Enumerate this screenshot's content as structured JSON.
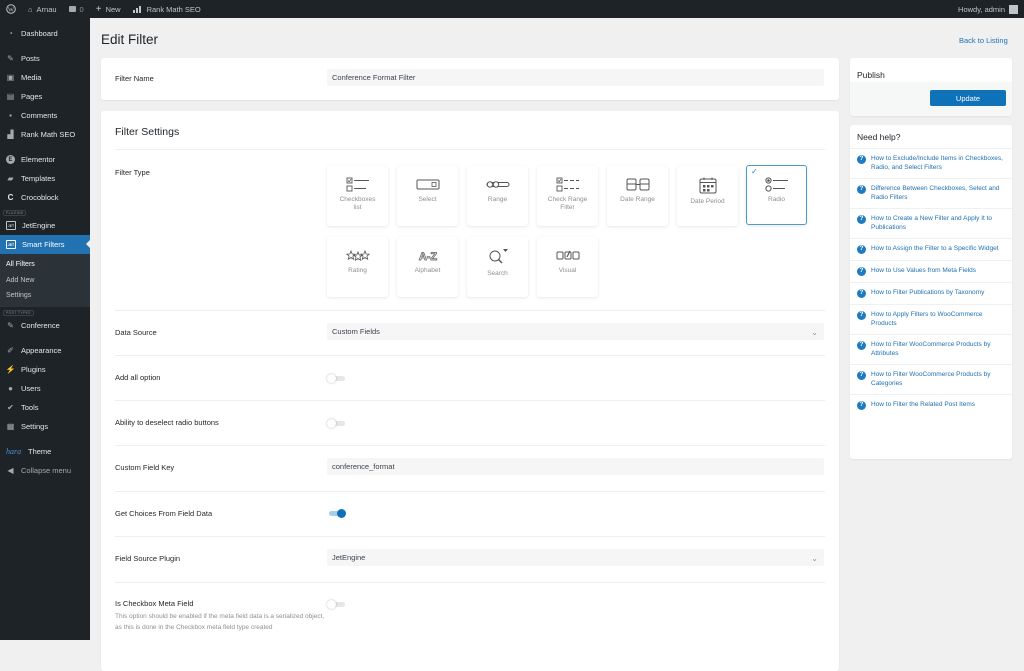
{
  "adminbar": {
    "site_name": "Arnau",
    "comments_count": "0",
    "new_label": "New",
    "seo_label": "Rank Math SEO",
    "howdy": "Howdy, admin"
  },
  "sidebar": {
    "items": [
      {
        "label": "Dashboard",
        "icon": "dashboard-icon"
      },
      {
        "label": "Posts",
        "icon": "pin-icon"
      },
      {
        "label": "Media",
        "icon": "media-icon"
      },
      {
        "label": "Pages",
        "icon": "pages-icon"
      },
      {
        "label": "Comments",
        "icon": "comment-icon"
      },
      {
        "label": "Rank Math SEO",
        "icon": "chart-icon"
      },
      {
        "label": "Elementor",
        "icon": "elementor-icon"
      },
      {
        "label": "Templates",
        "icon": "folder-icon"
      },
      {
        "label": "Crocoblock",
        "icon": "crocoblock-icon"
      },
      {
        "label": "JetEngine",
        "icon": "jet-icon"
      },
      {
        "label": "Smart Filters",
        "icon": "jet-icon"
      },
      {
        "label": "Conference",
        "icon": "pin-icon"
      },
      {
        "label": "Appearance",
        "icon": "brush-icon"
      },
      {
        "label": "Plugins",
        "icon": "plugin-icon"
      },
      {
        "label": "Users",
        "icon": "user-icon"
      },
      {
        "label": "Tools",
        "icon": "wrench-icon"
      },
      {
        "label": "Settings",
        "icon": "settings-icon"
      },
      {
        "label": "Theme",
        "icon": "hara-logo-icon",
        "prefix": "hara"
      },
      {
        "label": "Collapse menu",
        "icon": "collapse-icon"
      }
    ],
    "section_plugins": "PLUGINS",
    "section_post_types": "POST TYPES",
    "submenu": [
      "All Filters",
      "Add New",
      "Settings"
    ]
  },
  "page": {
    "title": "Edit Filter",
    "back_link": "Back to Listing"
  },
  "filter_name": {
    "label": "Filter Name",
    "value": "Conference Format Filter"
  },
  "settings": {
    "title": "Filter Settings",
    "filter_type_label": "Filter Type",
    "types": [
      {
        "label": "Checkboxes list",
        "icon": "checkboxes-icon",
        "selected": false
      },
      {
        "label": "Select",
        "icon": "select-icon",
        "selected": false
      },
      {
        "label": "Range",
        "icon": "range-icon",
        "selected": false
      },
      {
        "label": "Check Range Filter",
        "icon": "check-range-icon",
        "selected": false
      },
      {
        "label": "Date Range",
        "icon": "date-range-icon",
        "selected": false
      },
      {
        "label": "Date Period",
        "icon": "calendar-icon",
        "selected": false
      },
      {
        "label": "Radio",
        "icon": "radio-icon",
        "selected": true
      },
      {
        "label": "Rating",
        "icon": "stars-icon",
        "selected": false
      },
      {
        "label": "Alphabet",
        "icon": "alphabet-icon",
        "selected": false
      },
      {
        "label": "Search",
        "icon": "search-icon",
        "selected": false
      },
      {
        "label": "Visual",
        "icon": "visual-icon",
        "selected": false
      }
    ],
    "data_source": {
      "label": "Data Source",
      "value": "Custom Fields"
    },
    "add_all": {
      "label": "Add all option",
      "on": false
    },
    "deselect": {
      "label": "Ability to deselect radio buttons",
      "on": false
    },
    "custom_field_key": {
      "label": "Custom Field Key",
      "value": "conference_format"
    },
    "get_choices": {
      "label": "Get Choices From Field Data",
      "on": true
    },
    "field_source": {
      "label": "Field Source Plugin",
      "value": "JetEngine"
    },
    "is_checkbox": {
      "label": "Is Checkbox Meta Field",
      "on": false,
      "description": "This option should be enabled if the meta field data is a serialized object, as this is done in the Checkbox meta field type created"
    }
  },
  "publish": {
    "title": "Publish",
    "update_label": "Update"
  },
  "help": {
    "title": "Need help?",
    "links": [
      "How to Exclude/Include Items in Checkboxes, Radio, and Select Filters",
      "Difference Between Checkboxes, Select and Radio Filters",
      "How to Create a New Filter and Apply It to Publications",
      "How to Assign the Filter to a Specific Widget",
      "How to Use Values from Meta Fields",
      "How to Filter Publications by Taxonomy",
      "How to Apply Filters to WooCommerce Products",
      "How to Filter WooCommerce Products by Attributes",
      "How to Filter WooCommerce Products by Categories",
      "How to Filter the Related Post Items"
    ]
  }
}
